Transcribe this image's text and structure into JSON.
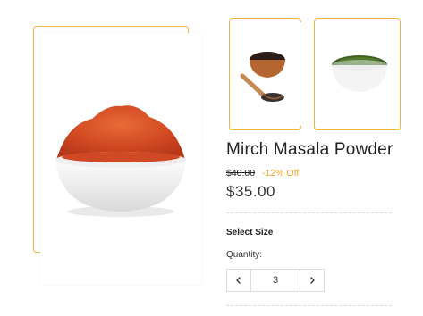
{
  "product": {
    "title": "Mirch Masala Powder",
    "old_price": "$40.00",
    "discount": "-12% Off",
    "price": "$35.00"
  },
  "options": {
    "select_size_label": "Select Size",
    "quantity_label": "Quantity:",
    "quantity_value": "3"
  },
  "icons": {
    "decrement": "chevron-left-icon",
    "increment": "chevron-right-icon"
  },
  "colors": {
    "accent": "#f3b53a",
    "discount": "#f3a425",
    "spice": "#d9502a"
  }
}
